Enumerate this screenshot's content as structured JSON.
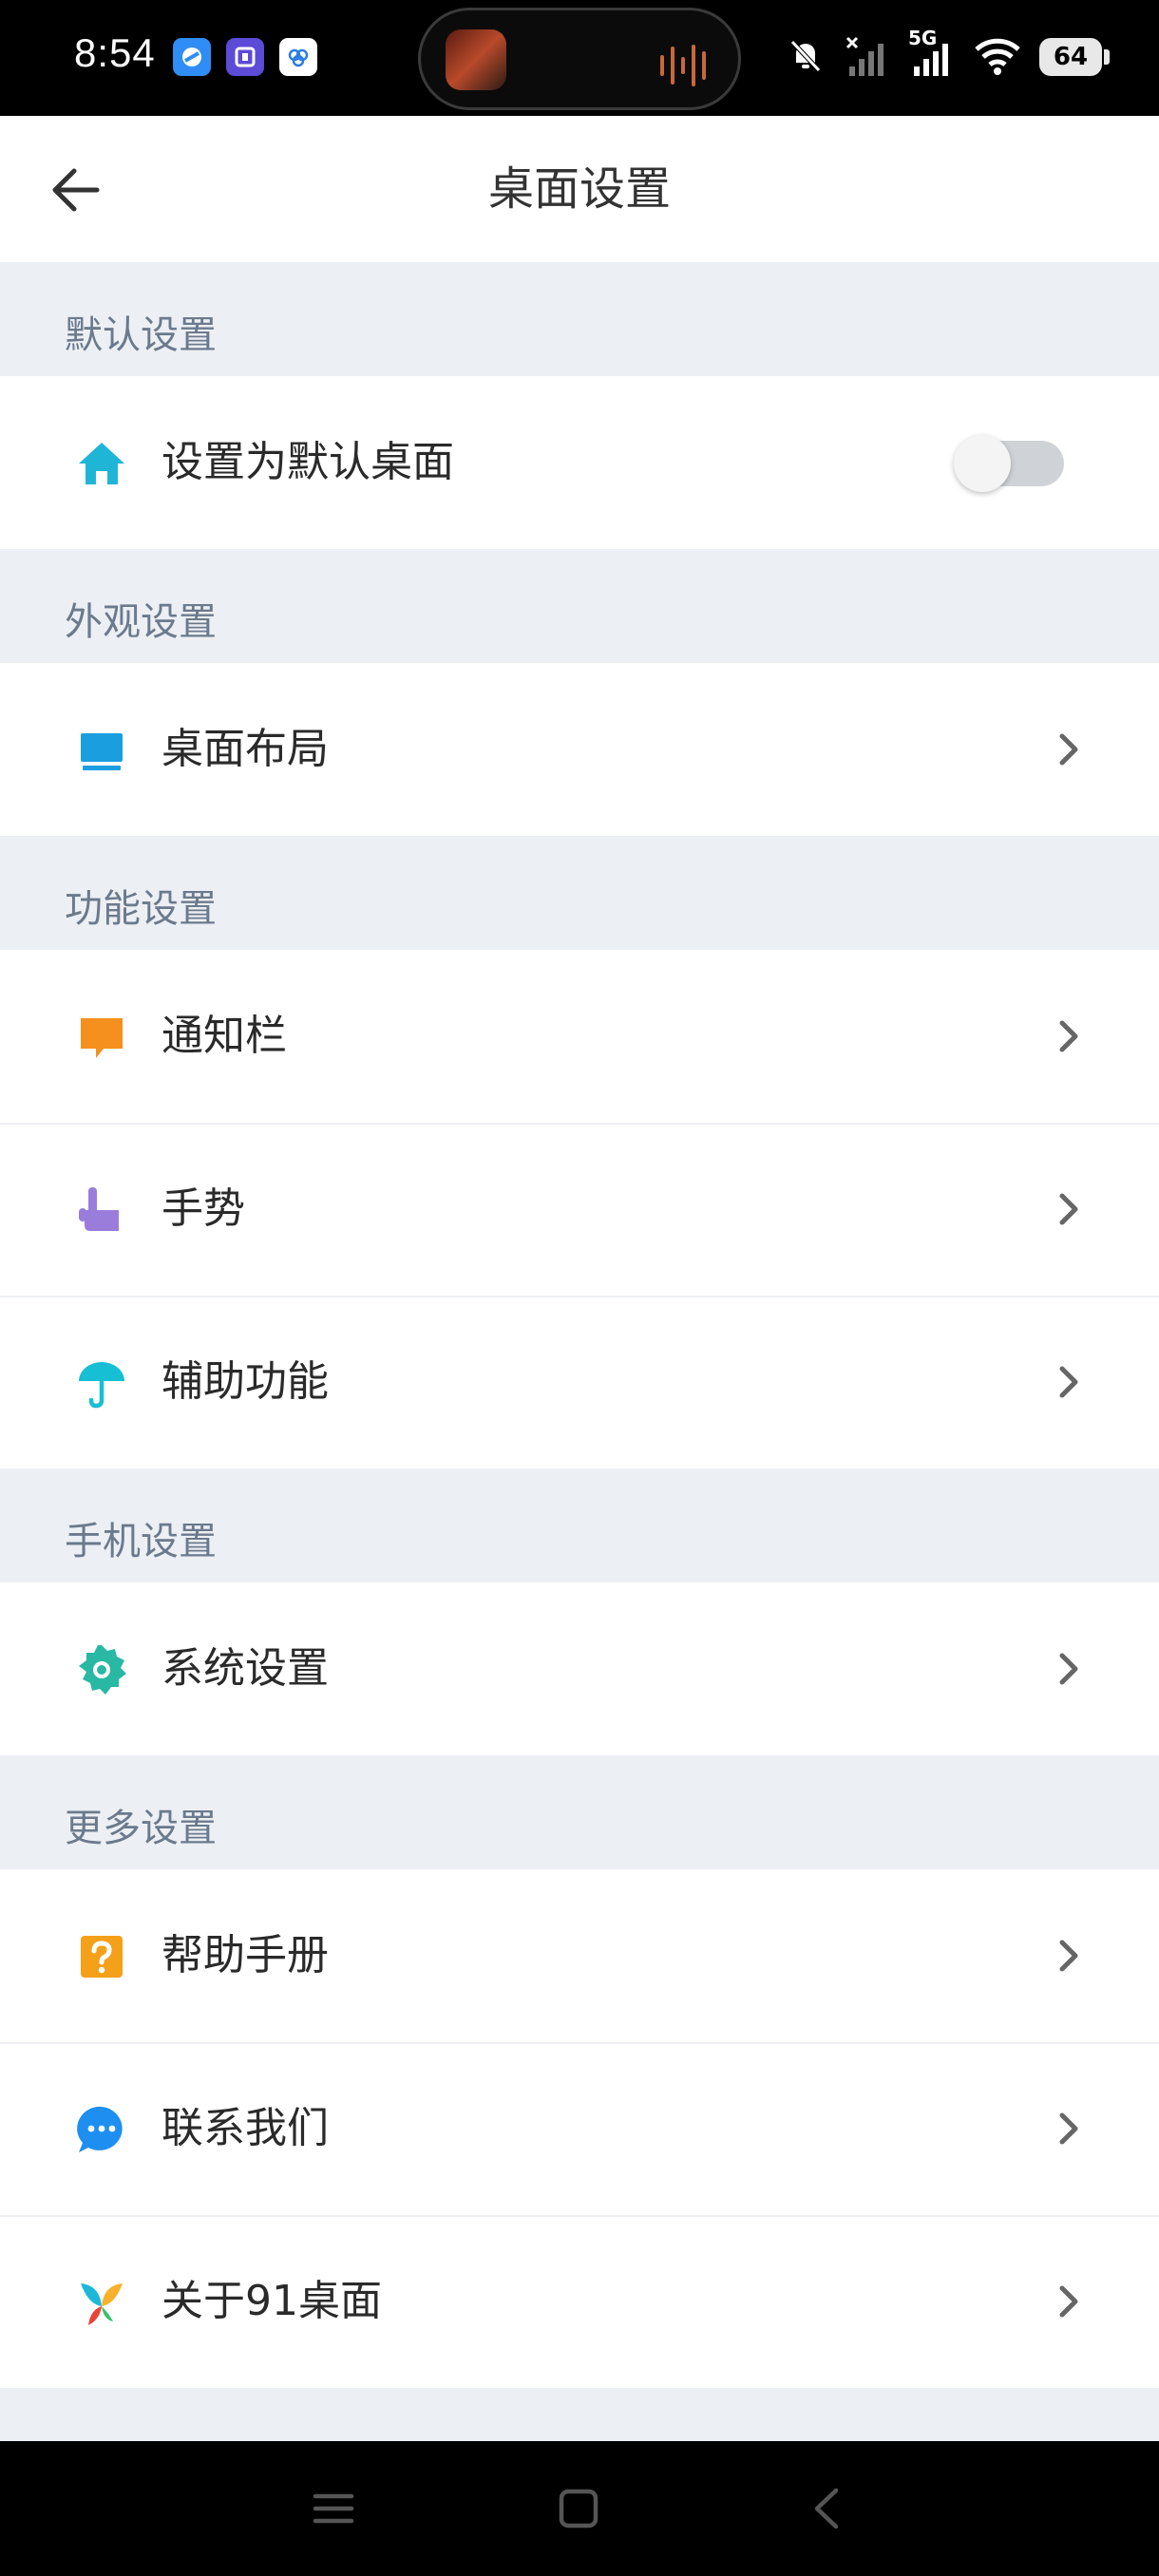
{
  "status_bar": {
    "time": "8:54",
    "app_icons": [
      "browser-icon",
      "tieba-icon",
      "cloud-app-icon"
    ],
    "battery": "64",
    "network": "5G"
  },
  "header": {
    "title": "桌面设置"
  },
  "sections": [
    {
      "title": "默认设置",
      "items": [
        {
          "label": "设置为默认桌面",
          "icon": "home-icon",
          "control": "toggle",
          "toggle_on": false
        }
      ]
    },
    {
      "title": "外观设置",
      "items": [
        {
          "label": "桌面布局",
          "icon": "monitor-icon",
          "control": "chevron"
        }
      ]
    },
    {
      "title": "功能设置",
      "items": [
        {
          "label": "通知栏",
          "icon": "notification-bubble-icon",
          "control": "chevron"
        },
        {
          "label": "手势",
          "icon": "hand-pointer-icon",
          "control": "chevron"
        },
        {
          "label": "辅助功能",
          "icon": "umbrella-icon",
          "control": "chevron"
        }
      ]
    },
    {
      "title": "手机设置",
      "items": [
        {
          "label": "系统设置",
          "icon": "gear-icon",
          "control": "chevron"
        }
      ]
    },
    {
      "title": "更多设置",
      "items": [
        {
          "label": "帮助手册",
          "icon": "help-icon",
          "control": "chevron"
        },
        {
          "label": "联系我们",
          "icon": "chat-icon",
          "control": "chevron"
        },
        {
          "label": "关于91桌面",
          "icon": "butterfly-logo-icon",
          "control": "chevron"
        }
      ]
    }
  ],
  "colors": {
    "home": "#1fb5d6",
    "monitor": "#1a9ee0",
    "notification": "#f5901e",
    "gesture": "#9a7ddb",
    "umbrella": "#16bfd4",
    "gear": "#28b8a3",
    "help": "#f5a019",
    "chat": "#1e8ff0",
    "background": "#eceff4",
    "section_title": "#6b7a8c"
  }
}
